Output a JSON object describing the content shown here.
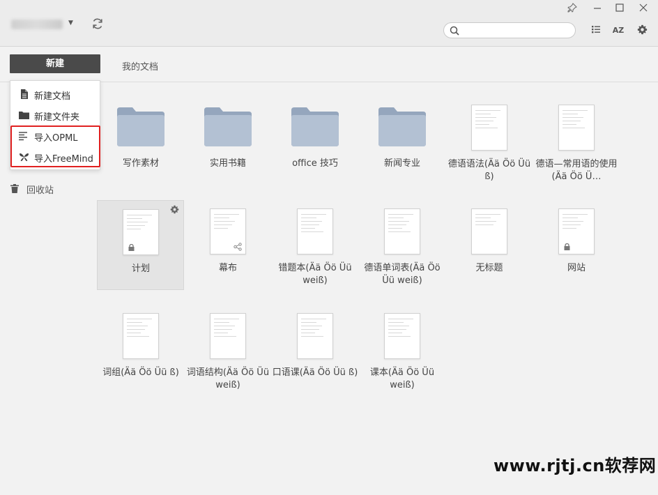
{
  "window": {
    "controls": {
      "pin": "pin-icon",
      "minimize": "minimize-icon",
      "maximize": "maximize-icon",
      "close": "close-icon"
    }
  },
  "header": {
    "search_placeholder": "",
    "sort_label": "AZ"
  },
  "tabs": {
    "new_label": "新建",
    "mydocs_label": "我的文档"
  },
  "new_menu": {
    "items": [
      {
        "label": "新建文档",
        "icon": "document-icon"
      },
      {
        "label": "新建文件夹",
        "icon": "folder-icon"
      },
      {
        "label": "导入OPML",
        "icon": "outline-icon"
      },
      {
        "label": "导入FreeMind",
        "icon": "butterfly-icon"
      }
    ],
    "highlight_color": "#e02020"
  },
  "sidebar": {
    "trash_label": "回收站"
  },
  "grid": {
    "row1": [
      {
        "label": "写作素材",
        "kind": "folder"
      },
      {
        "label": "实用书籍",
        "kind": "folder"
      },
      {
        "label": "office 技巧",
        "kind": "folder"
      },
      {
        "label": "新闻专业",
        "kind": "folder"
      },
      {
        "label": "德语语法(Ää Öö Üü ß)",
        "kind": "doc"
      },
      {
        "label": "德语—常用语的使用(Ää Öö Ü…",
        "kind": "doc"
      }
    ],
    "row2": [
      {
        "label": "计划",
        "kind": "doc",
        "badge": "lock",
        "selected": true
      },
      {
        "label": "幕布",
        "kind": "doc",
        "badge": "share"
      },
      {
        "label": "错题本(Ää Öö Üü weiß)",
        "kind": "doc"
      },
      {
        "label": "德语单词表(Ää Öö Üü weiß)",
        "kind": "doc"
      },
      {
        "label": "无标题",
        "kind": "doc"
      },
      {
        "label": "网站",
        "kind": "doc",
        "badge": "lock"
      }
    ],
    "row3": [
      {
        "label": "词组(Ää Öö Üü ß)",
        "kind": "doc"
      },
      {
        "label": "词语结构(Ää Öö Üü weiß)",
        "kind": "doc"
      },
      {
        "label": "口语课(Ää Öö Üü ß)",
        "kind": "doc"
      },
      {
        "label": "课本(Ää Öö Üü weiß)",
        "kind": "doc"
      }
    ]
  },
  "watermark": "www.rjtj.cn软荐网",
  "colors": {
    "accent_dark": "#4a4a4a",
    "folder": "#a9b8cc",
    "background": "#f2f2f2"
  }
}
